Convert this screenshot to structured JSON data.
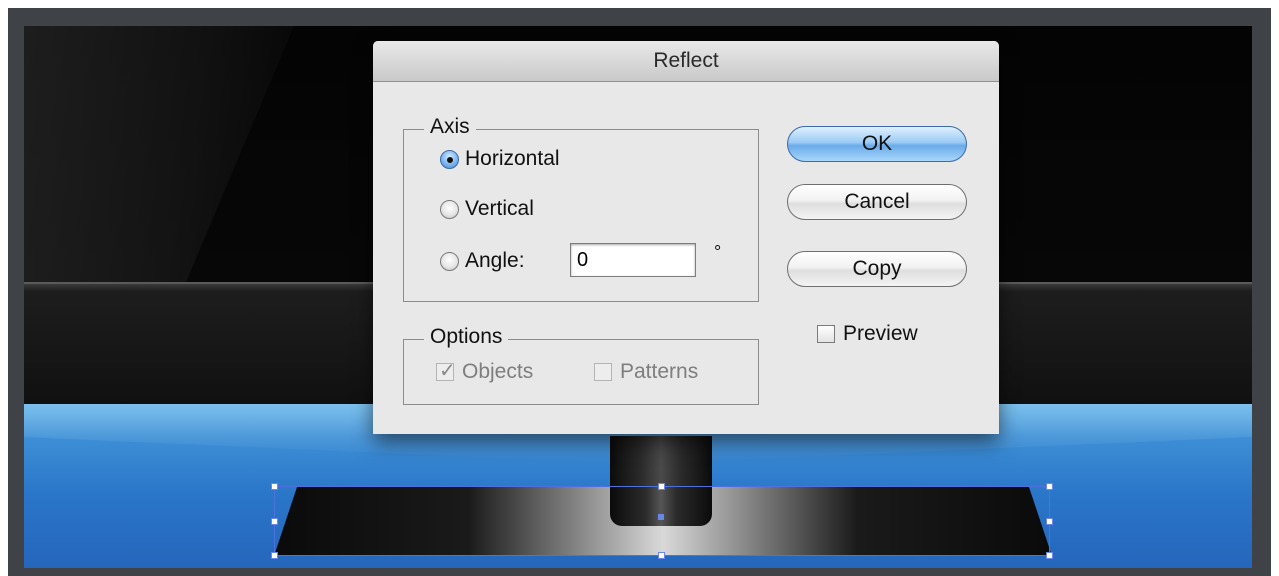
{
  "dialog": {
    "title": "Reflect",
    "axis": {
      "title": "Axis",
      "selected": "Horizontal",
      "options": [
        "Horizontal",
        "Vertical",
        "Angle:"
      ],
      "angle_value": "0",
      "degree_symbol": "°"
    },
    "options_group": {
      "title": "Options",
      "objects_label": "Objects",
      "objects_checked": true,
      "patterns_label": "Patterns",
      "patterns_checked": false
    },
    "buttons": {
      "ok": "OK",
      "cancel": "Cancel",
      "copy": "Copy"
    },
    "preview": {
      "label": "Preview",
      "checked": false
    }
  }
}
